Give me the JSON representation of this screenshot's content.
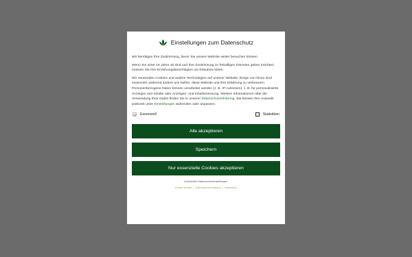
{
  "dialog": {
    "title": "Einstellungen zum Datenschutz",
    "logo_icon": "leaf-lotus-icon",
    "accent_color": "#0b4d1d",
    "paragraph1": "Wir benötigen Ihre Zustimmung, bevor Sie unsere Website weiter besuchen können.",
    "paragraph2": "Wenn Sie unter 16 Jahre alt sind und Ihre Zustimmung zu freiwilligen Diensten geben möchten, müssen Sie Ihre Erziehungsberechtigten um Erlaubnis bitten.",
    "paragraph3_part1": "Wir verwenden Cookies und andere Technologien auf unserer Website. Einige von ihnen sind essenziell, während andere uns helfen, diese Website und Ihre Erfahrung zu verbessern. Personenbezogene Daten können verarbeitet werden (z. B. IP-Adressen), z. B. für personalisierte Anzeigen und Inhalte oder Anzeigen- und Inhaltsmessung. Weitere Informationen über die Verwendung Ihrer Daten finden Sie in unserer ",
    "paragraph3_link1": "Datenschutzerklärung",
    "paragraph3_part2": ". Sie können Ihre Auswahl jederzeit unter ",
    "paragraph3_link2": "Einstellungen",
    "paragraph3_part3": " widerrufen oder anpassen."
  },
  "checkboxes": {
    "essential_label": "Essenziell",
    "essential_checked": true,
    "essential_disabled": true,
    "statistics_label": "Statistiken",
    "statistics_checked": false
  },
  "buttons": {
    "accept_all": "Alle akzeptieren",
    "save": "Speichern",
    "essential_only": "Nur essenzielle Cookies akzeptieren"
  },
  "footer": {
    "individual_settings": "Individuelle Datenschutzeinstellungen",
    "link_cookie_details": "Cookie-Details",
    "link_privacy": "Datenschutzerklärung",
    "link_imprint": "Impressum",
    "separator": "|"
  }
}
